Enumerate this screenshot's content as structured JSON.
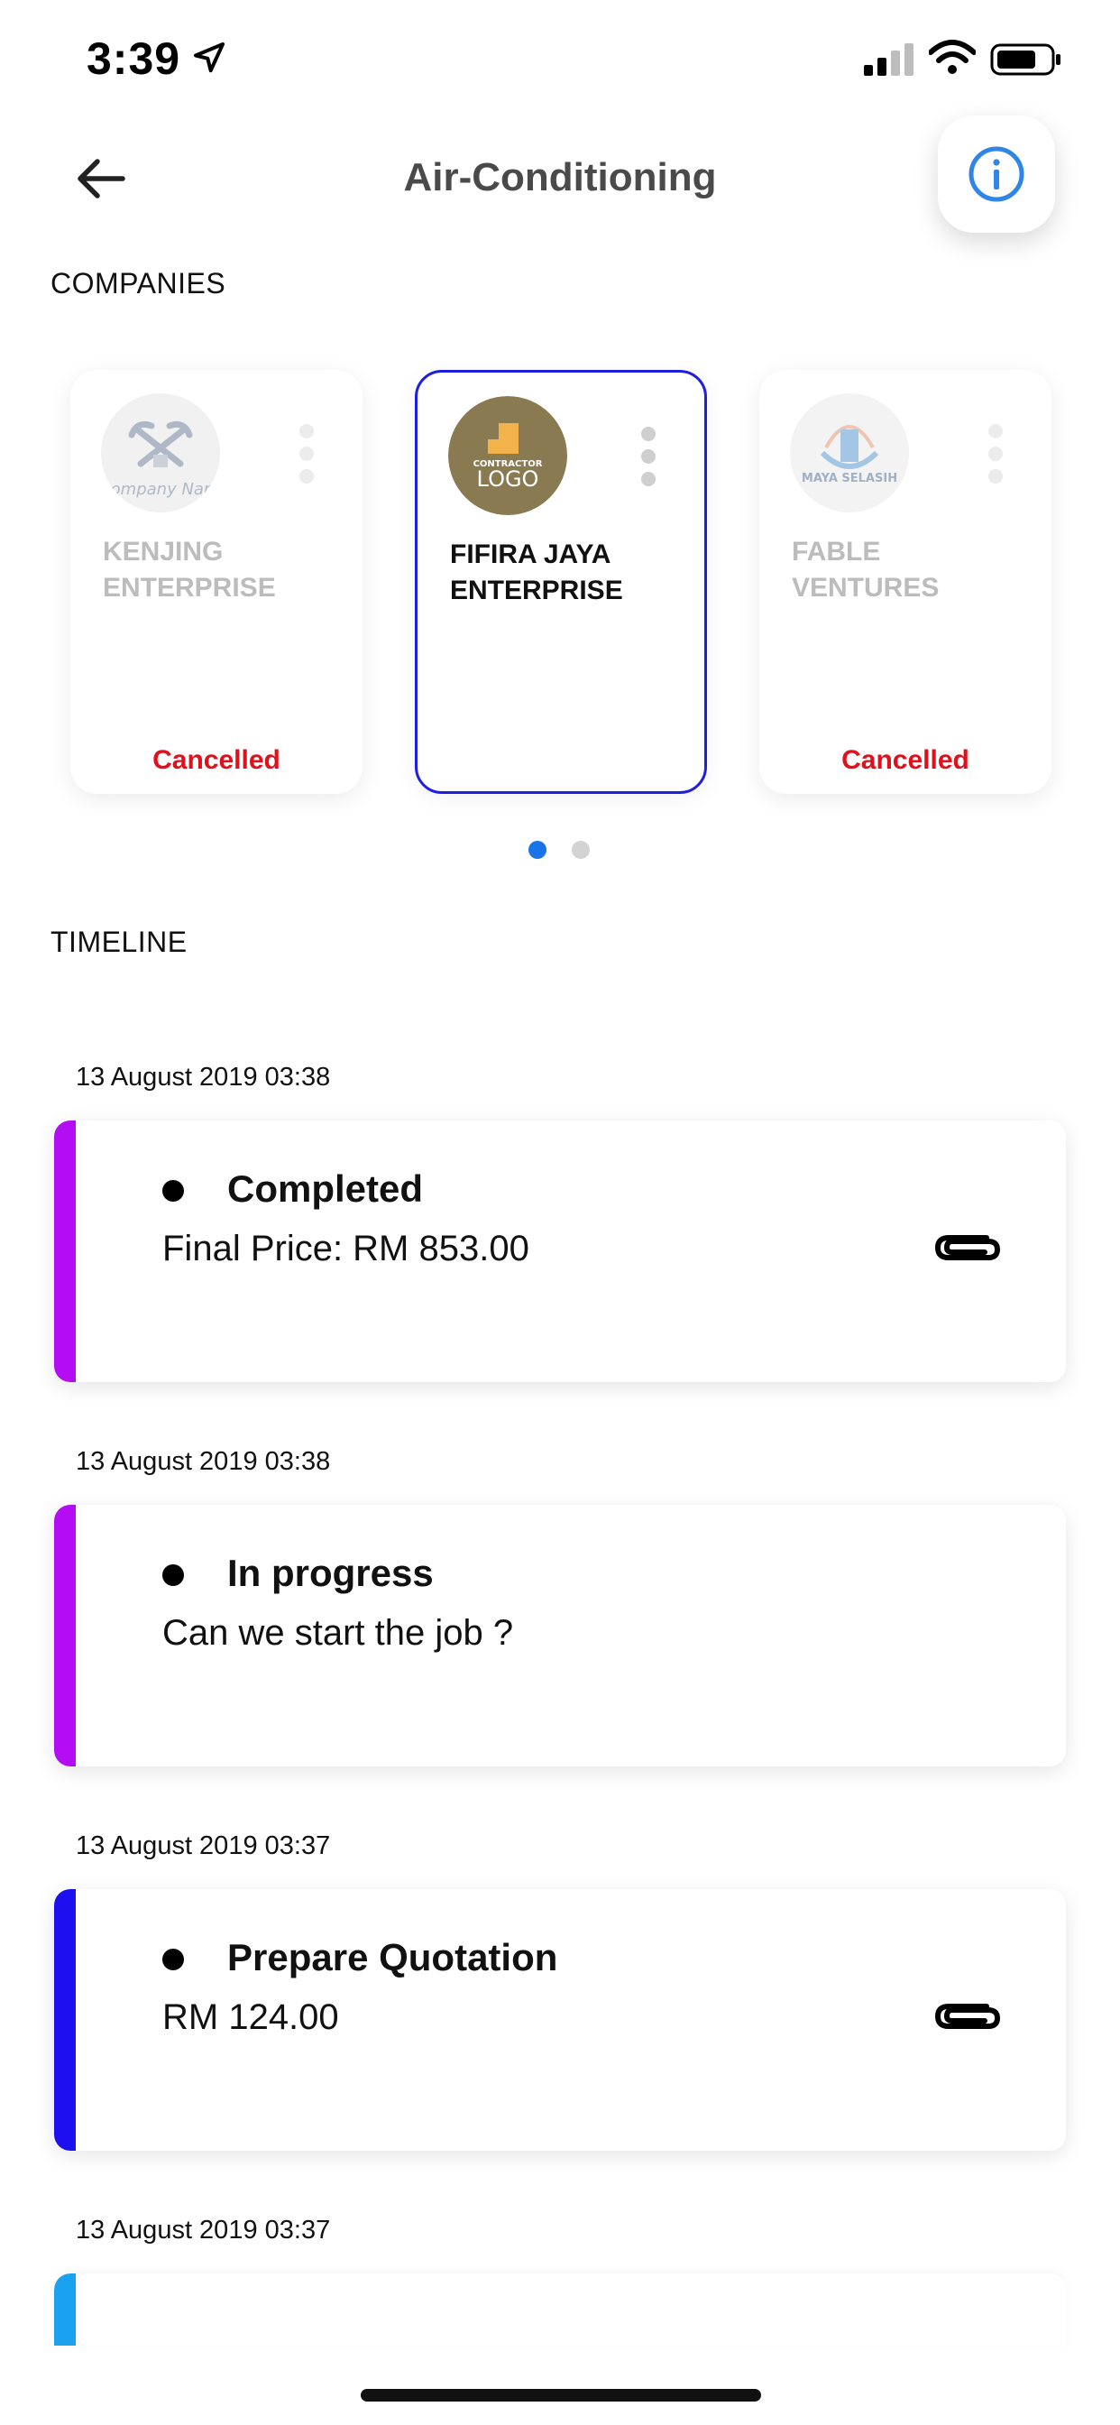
{
  "status_bar": {
    "time": "3:39"
  },
  "header": {
    "title": "Air-Conditioning"
  },
  "sections": {
    "companies": "COMPANIES",
    "timeline": "TIMELINE"
  },
  "companies": [
    {
      "logo_text": "Company Name",
      "name": "KENJING ENTERPRISE",
      "status": "Cancelled",
      "selected": false
    },
    {
      "logo_text": "CONTRACTOR LOGO",
      "name": "FIFIRA JAYA ENTERPRISE",
      "status": "",
      "selected": true
    },
    {
      "logo_text": "MAYA SELASIH",
      "name": "FABLE VENTURES",
      "status": "Cancelled",
      "selected": false
    }
  ],
  "pagination": {
    "pages": 2,
    "active": 1
  },
  "timeline": [
    {
      "date": "13 August 2019 03:38",
      "title": "Completed",
      "desc": "Final Price: RM 853.00",
      "bar_color": "#b40cf3",
      "attachment": true
    },
    {
      "date": "13 August 2019 03:38",
      "title": "In progress",
      "desc": "Can we start the job ?",
      "bar_color": "#b40cf3",
      "attachment": false
    },
    {
      "date": "13 August 2019 03:37",
      "title": "Prepare Quotation",
      "desc": "RM 124.00",
      "bar_color": "#1e0ff0",
      "attachment": true
    },
    {
      "date": "13 August 2019 03:37",
      "title": "",
      "desc": "",
      "bar_color": "#1aa2f0",
      "attachment": false
    }
  ],
  "icons": {
    "back": "arrow-left-icon",
    "info": "info-circle-icon",
    "more": "more-vertical-icon",
    "attachment": "paperclip-icon"
  }
}
